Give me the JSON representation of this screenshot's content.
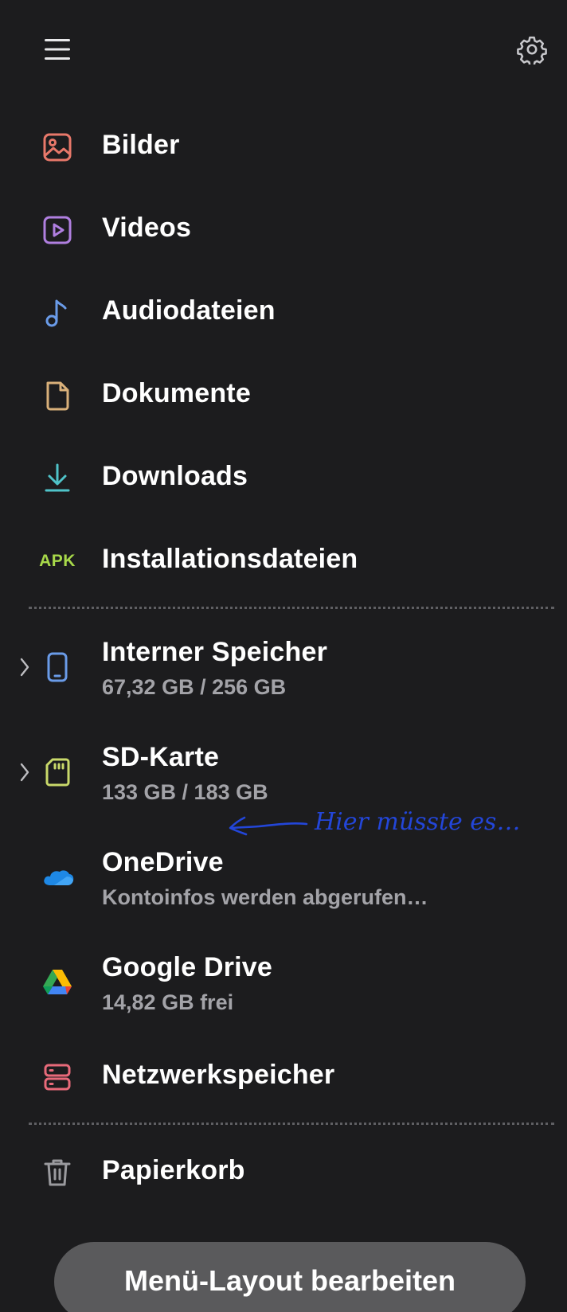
{
  "header": {
    "menu_icon": "hamburger-menu-icon",
    "settings_icon": "gear-icon"
  },
  "categories": [
    {
      "label": "Bilder",
      "icon": "image-icon",
      "color": "#e8786a"
    },
    {
      "label": "Videos",
      "icon": "play-icon",
      "color": "#b07fe0"
    },
    {
      "label": "Audiodateien",
      "icon": "music-note-icon",
      "color": "#6a9be8"
    },
    {
      "label": "Dokumente",
      "icon": "document-icon",
      "color": "#d9b07a"
    },
    {
      "label": "Downloads",
      "icon": "download-icon",
      "color": "#4fc3c9"
    },
    {
      "label": "Installationsdateien",
      "icon": "apk-icon",
      "icon_text": "APK",
      "color": "#a8d94a"
    }
  ],
  "storage": [
    {
      "label": "Interner Speicher",
      "sub": "67,32 GB / 256 GB",
      "icon": "phone-icon",
      "color": "#6a9be8",
      "expandable": true
    },
    {
      "label": "SD-Karte",
      "sub": "133 GB / 183 GB",
      "icon": "sd-card-icon",
      "color": "#c9d96a",
      "expandable": true
    },
    {
      "label": "OneDrive",
      "sub": "Kontoinfos werden abgerufen…",
      "icon": "onedrive-icon",
      "color": "#1e88e5",
      "expandable": false
    },
    {
      "label": "Google Drive",
      "sub": "14,82 GB frei",
      "icon": "google-drive-icon",
      "color": "#34a853",
      "expandable": false
    },
    {
      "label": "Netzwerkspeicher",
      "icon": "network-storage-icon",
      "color": "#e86a7a",
      "expandable": false
    }
  ],
  "trash": {
    "label": "Papierkorb",
    "icon": "trash-icon",
    "color": "#9a9a9e"
  },
  "annotation": {
    "text": "Hier müsste es…",
    "color": "#2346d9"
  },
  "footer": {
    "edit_layout_label": "Menü-Layout bearbeiten"
  }
}
